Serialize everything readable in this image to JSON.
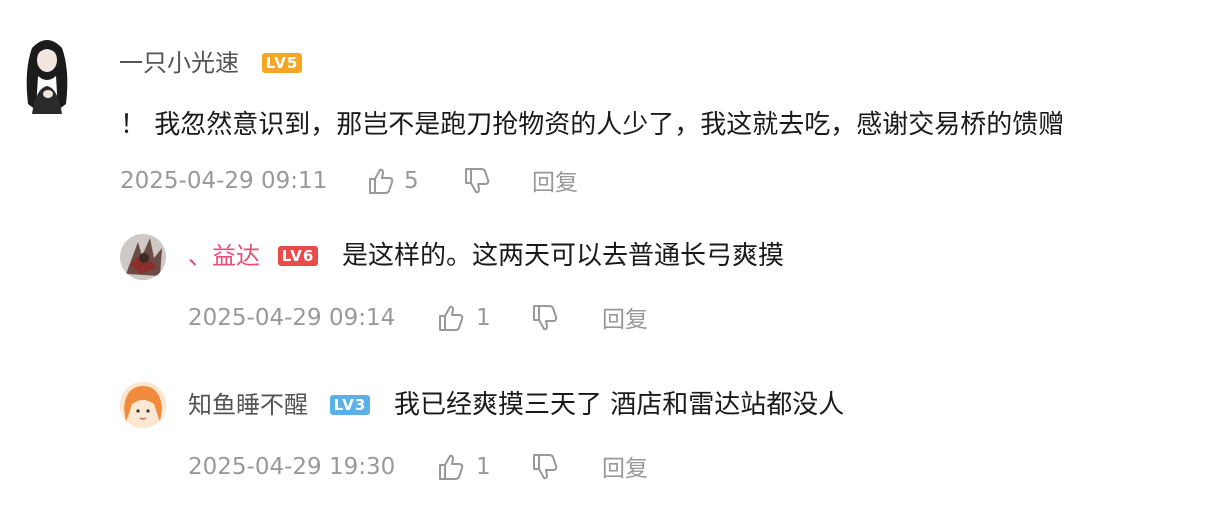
{
  "comments": [
    {
      "username": "一只小光速",
      "level": "LV5",
      "content": "！ 我忽然意识到，那岂不是跑刀抢物资的人少了，我这就去吃，感谢交易桥的馈赠",
      "timestamp": "2025-04-29 09:11",
      "likes": "5",
      "reply_label": "回复",
      "replies": [
        {
          "username": "、益达",
          "level": "LV6",
          "content": "是这样的。这两天可以去普通长弓爽摸",
          "timestamp": "2025-04-29 09:14",
          "likes": "1",
          "reply_label": "回复"
        },
        {
          "username": "知鱼睡不醒",
          "level": "LV3",
          "content": "我已经爽摸三天了 酒店和雷达站都没人",
          "timestamp": "2025-04-29 19:30",
          "likes": "1",
          "reply_label": "回复"
        }
      ]
    }
  ],
  "colors": {
    "username_default": "#555555",
    "username_vip": "#e8507a",
    "level_lv5": "#f5a623",
    "level_lv6": "#e94a4a",
    "level_lv3": "#5ab0e8",
    "meta_text": "#999999",
    "content_text": "#1a1a1a"
  },
  "icons": {
    "like": "thumbs-up-icon",
    "dislike": "thumbs-down-icon"
  }
}
